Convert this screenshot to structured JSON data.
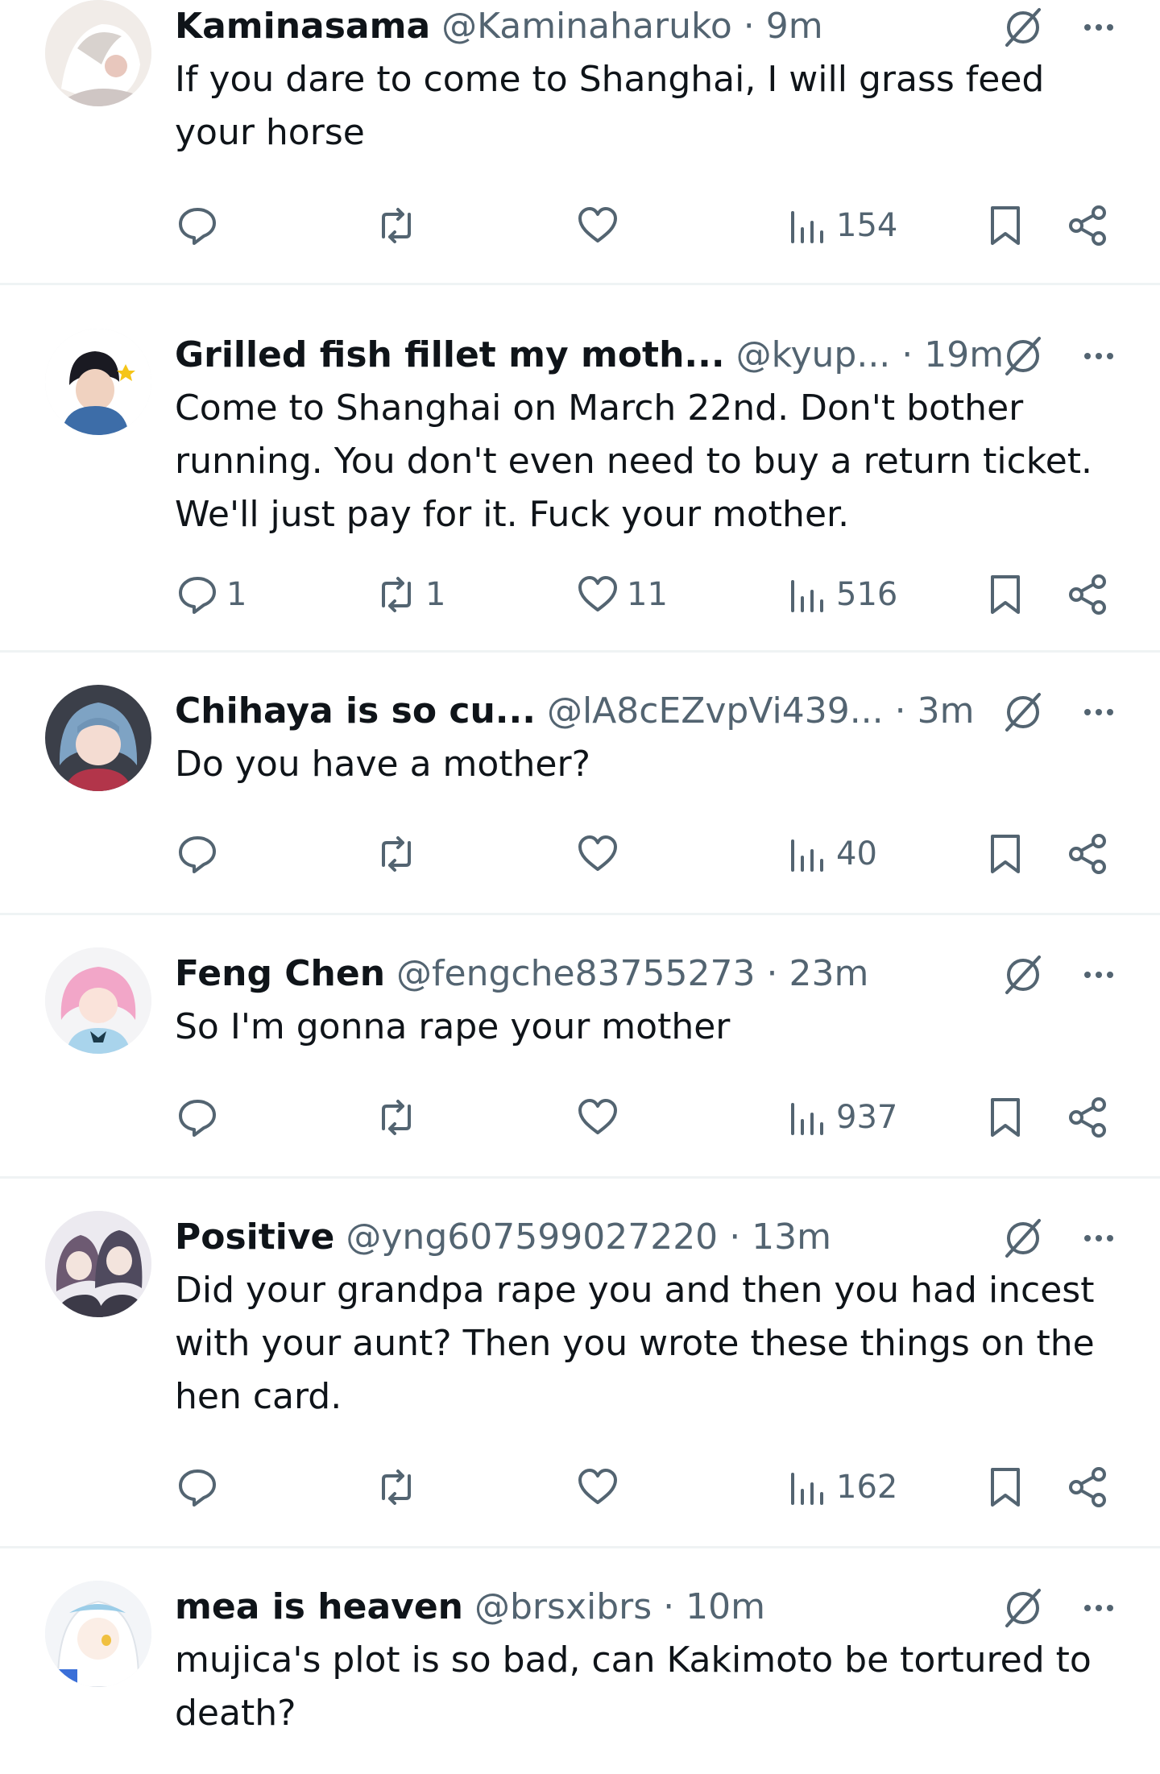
{
  "tweets": [
    {
      "name": "Kaminasama",
      "handle": "@Kaminaharuko",
      "time": "· 9m",
      "text": "If you dare to come to Shanghai, I will grass feed\nyour horse",
      "replies": "",
      "retweets": "",
      "likes": "",
      "views": "154",
      "avatar_color": "#f1ece8"
    },
    {
      "name": "Grilled fish fillet my moth...",
      "handle": "@kyup...",
      "time": "· 19m",
      "text": "Come to Shanghai on March 22nd. Don't bother\nrunning. You don't even need to buy a return ticket.\nWe'll just pay for it. Fuck your mother.",
      "replies": "1",
      "retweets": "1",
      "likes": "11",
      "views": "516",
      "avatar_color": "#ffffff"
    },
    {
      "name": "Chihaya is so cu...",
      "handle": "@lA8cEZvpVi439...",
      "time": "· 3m",
      "text": "Do you have a mother?",
      "replies": "",
      "retweets": "",
      "likes": "",
      "views": "40",
      "avatar_color": "#3b3f49"
    },
    {
      "name": "Feng Chen",
      "handle": "@fengche83755273",
      "time": "· 23m",
      "text": "So I'm gonna rape your mother",
      "replies": "",
      "retweets": "",
      "likes": "",
      "views": "937",
      "avatar_color": "#f4f4f6"
    },
    {
      "name": "Positive",
      "handle": "@yng607599027220",
      "time": "· 13m",
      "text": "Did your grandpa rape you and then you had incest\nwith your aunt? Then you wrote these things on the\nhen card.",
      "replies": "",
      "retweets": "",
      "likes": "",
      "views": "162",
      "avatar_color": "#eceaf0"
    },
    {
      "name": "mea is heaven",
      "handle": "@brsxibrs",
      "time": "· 10m",
      "text": "mujica's plot is so bad, can Kakimoto be tortured to\ndeath?",
      "replies": "",
      "retweets": "",
      "likes": "",
      "views": "",
      "avatar_color": "#f3f5f8"
    }
  ],
  "colors": {
    "text": "#0f1419",
    "secondary": "#536471",
    "divider": "#eff3f4"
  },
  "icons": [
    "reply-icon",
    "retweet-icon",
    "like-icon",
    "views-icon",
    "bookmark-icon",
    "share-icon",
    "mute-icon",
    "more-icon"
  ]
}
